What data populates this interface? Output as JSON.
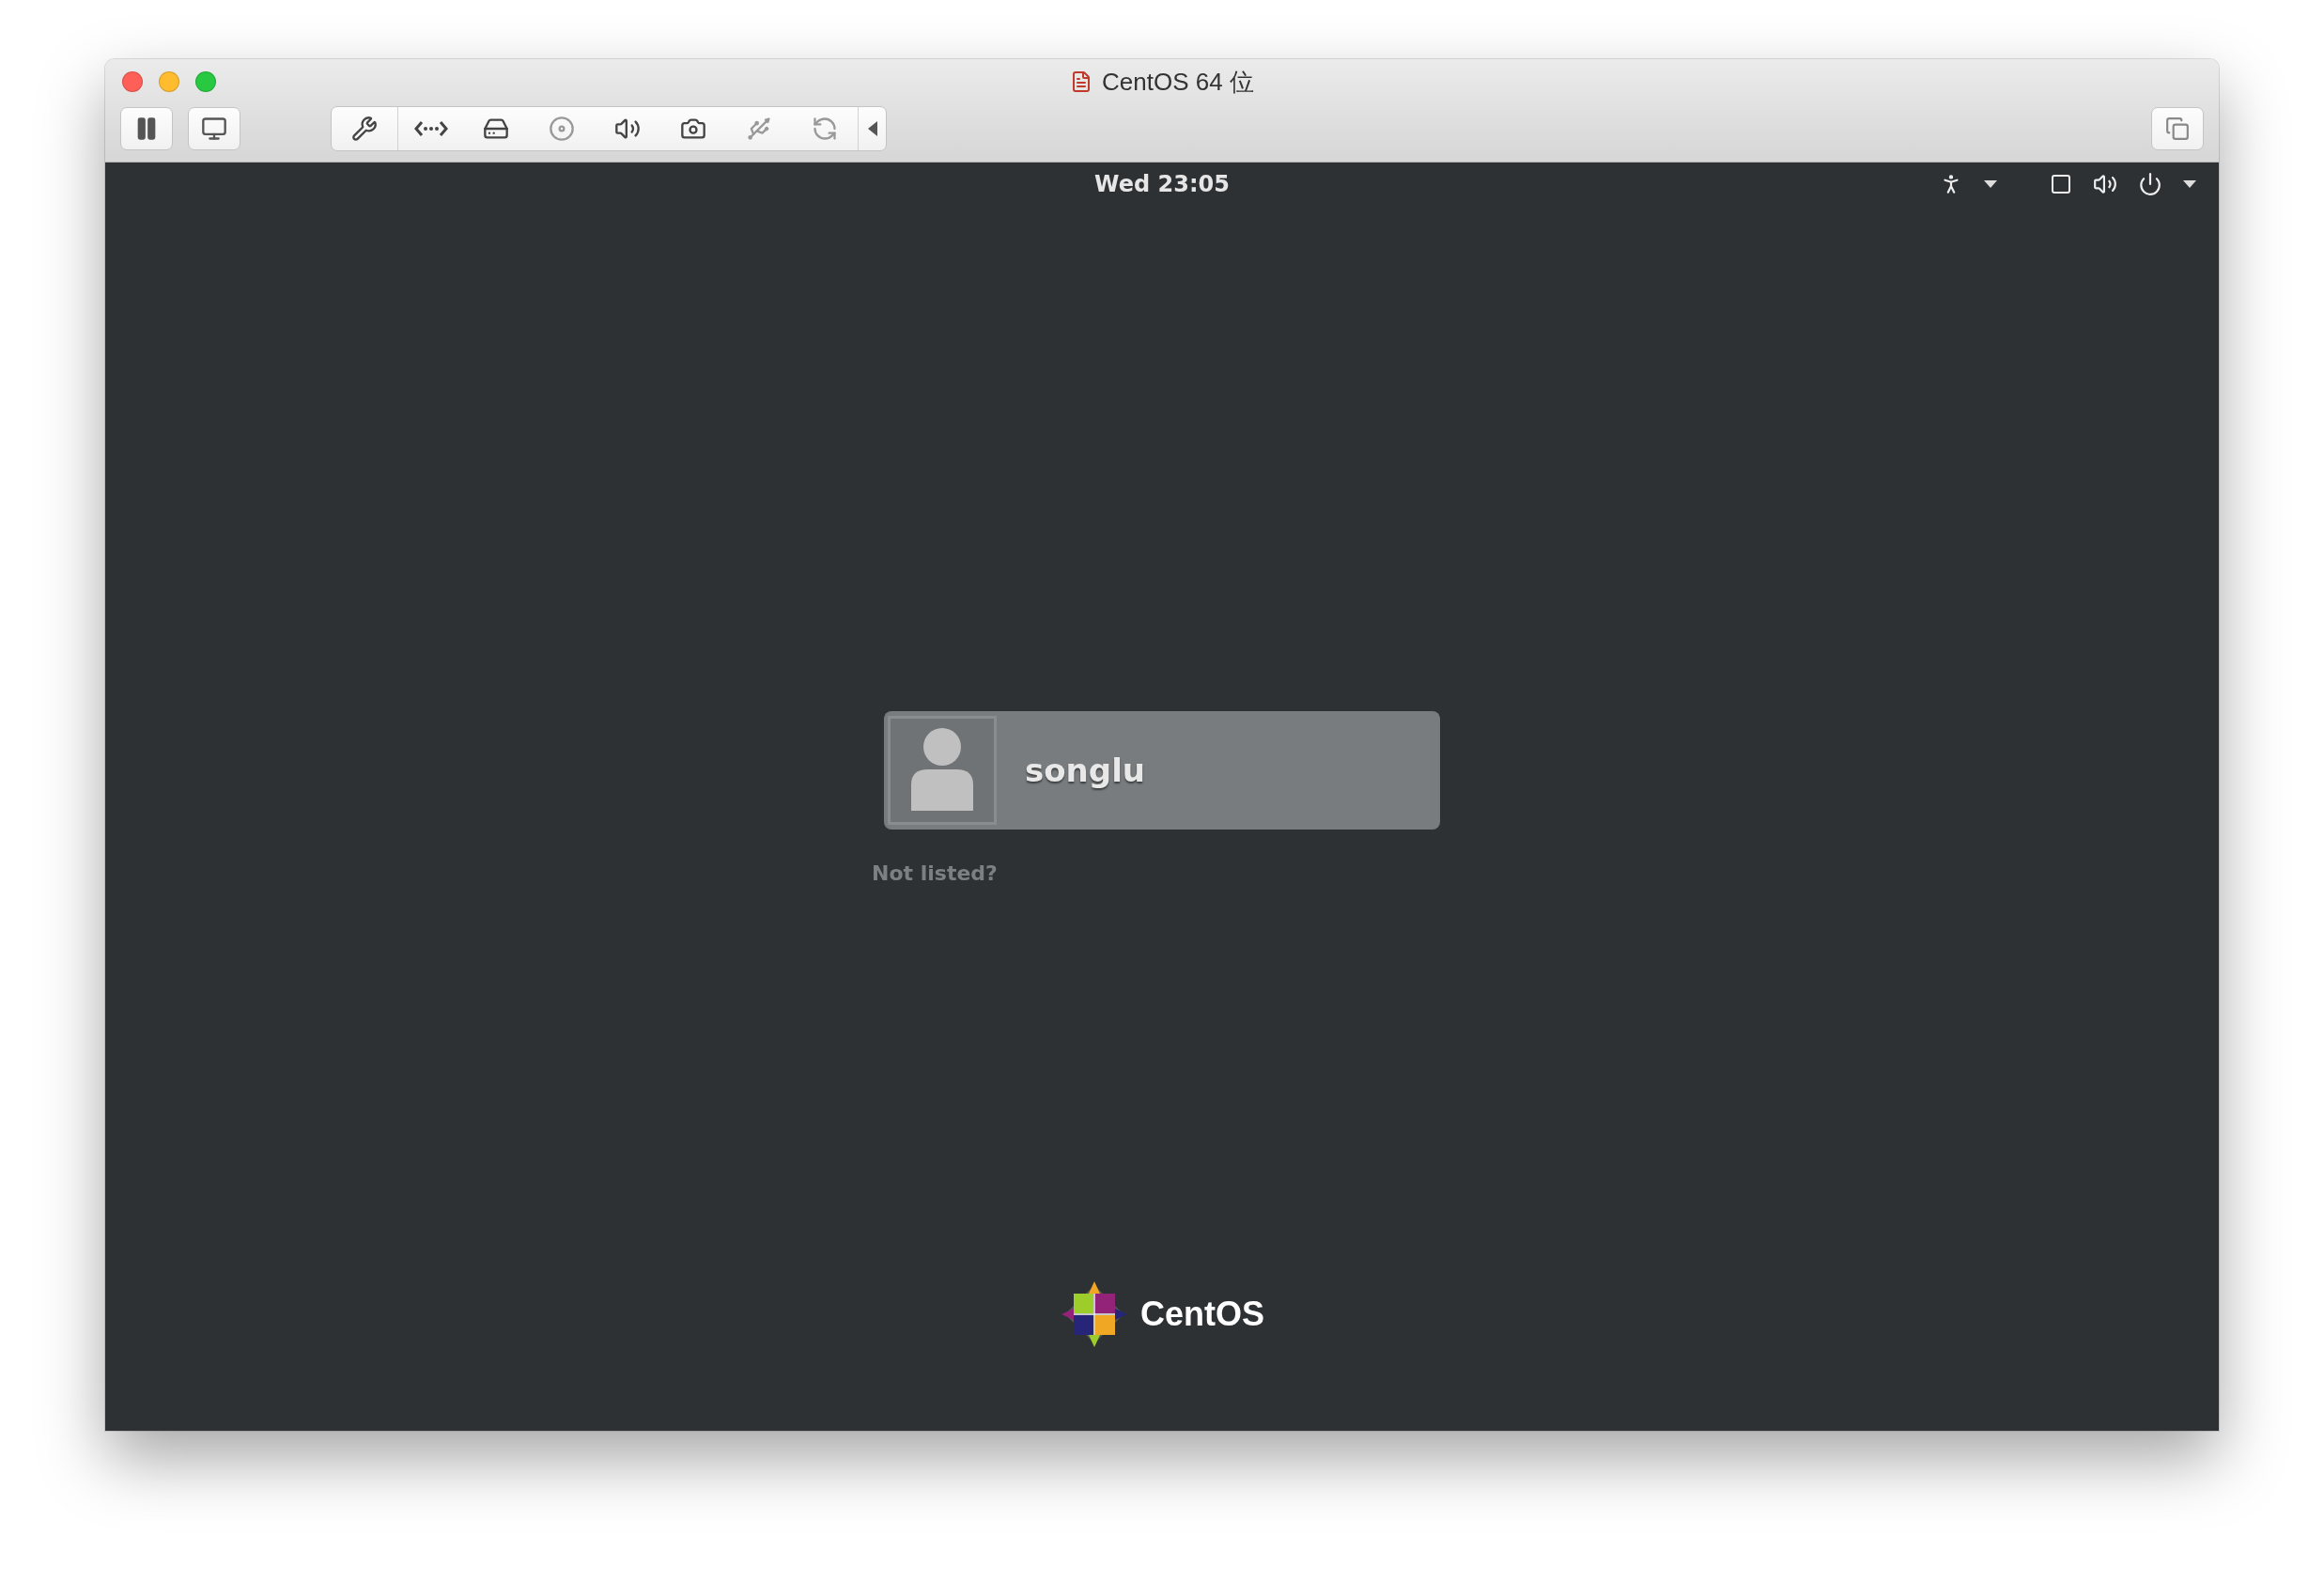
{
  "window": {
    "title": "CentOS 64 位"
  },
  "top_bar": {
    "clock": "Wed 23:05"
  },
  "login": {
    "users": [
      {
        "name": "songlu"
      }
    ],
    "not_listed": "Not listed?"
  },
  "logo": {
    "text": "CentOS"
  }
}
